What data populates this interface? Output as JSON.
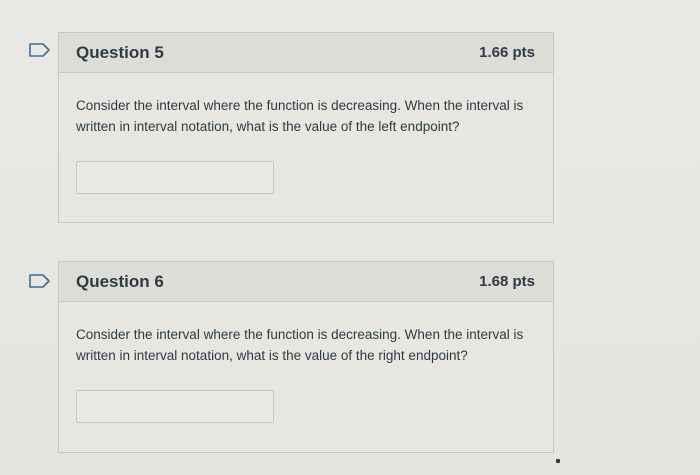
{
  "questions": [
    {
      "title": "Question 5",
      "points": "1.66 pts",
      "text": "Consider the interval where the function is decreasing. When the interval is written in interval notation, what is the value of the left endpoint?",
      "answer_value": ""
    },
    {
      "title": "Question 6",
      "points": "1.68 pts",
      "text": "Consider the interval where the function is decreasing. When the interval is written in interval notation, what is the value of the right endpoint?",
      "answer_value": ""
    }
  ],
  "icons": {
    "flag": "flag-question-icon"
  },
  "colors": {
    "background": "#e9e7e2",
    "header": "#dedcd7",
    "border": "#c9c7c2",
    "text": "#2d3b45",
    "flag": "#3a6f9a"
  }
}
